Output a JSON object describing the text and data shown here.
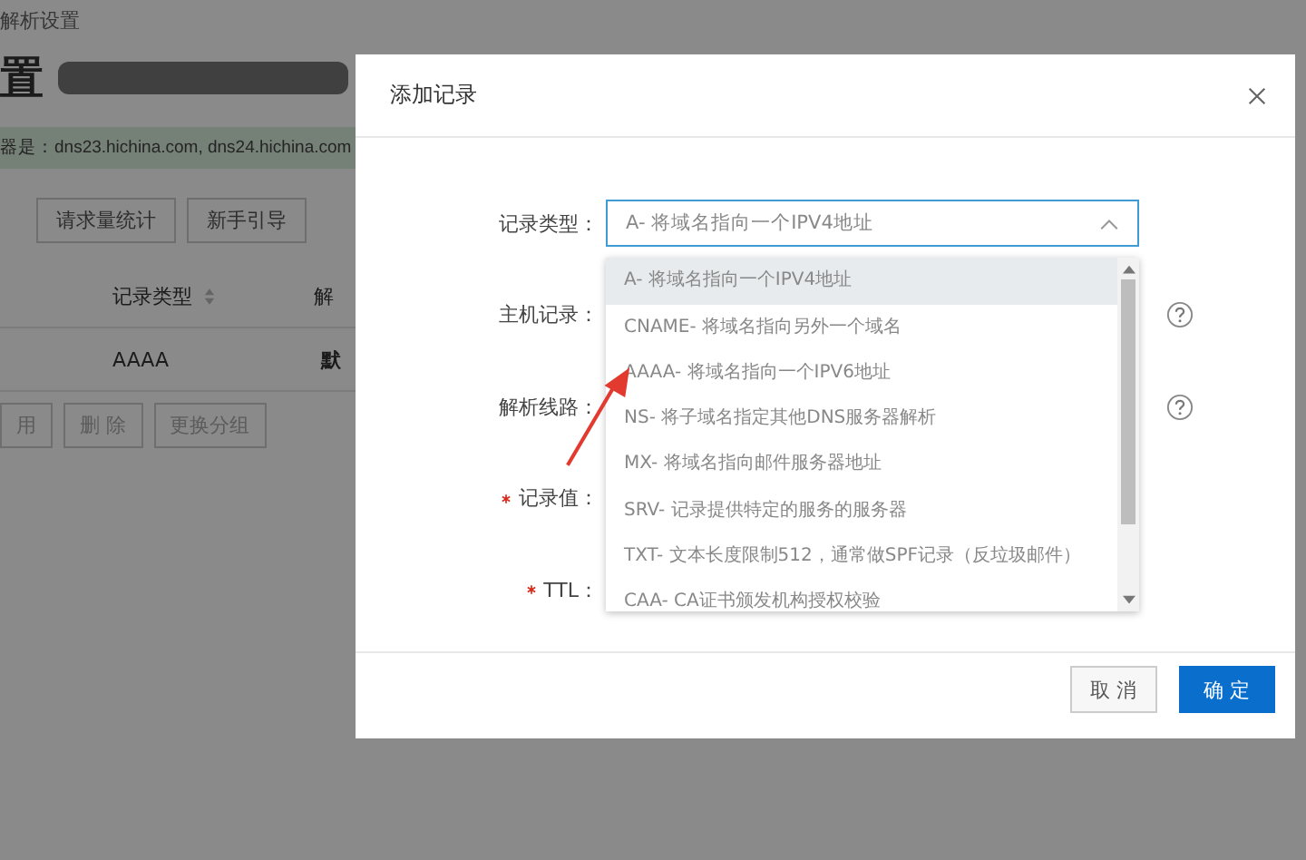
{
  "page": {
    "breadcrumb": "解析设置",
    "heading": "置",
    "dns_notice": "器是：dns23.hichina.com, dns24.hichina.com",
    "toolbar_buttons": [
      "请求量统计",
      "新手引导"
    ],
    "table": {
      "columns": [
        "记录类型",
        "解"
      ],
      "rows": [
        [
          "AAAA",
          "默"
        ]
      ]
    },
    "action_buttons": [
      "用",
      "删 除",
      "更换分组"
    ]
  },
  "dialog": {
    "title": "添加记录",
    "fields": [
      {
        "label": "记录类型：",
        "required": false,
        "help": false
      },
      {
        "label": "主机记录：",
        "required": false,
        "help": true
      },
      {
        "label": "解析线路：",
        "required": false,
        "help": true
      },
      {
        "label": "记录值：",
        "required": true,
        "help": false
      },
      {
        "label": "TTL：",
        "required": true,
        "help": false
      }
    ],
    "select": {
      "value": "A- 将域名指向一个IPV4地址",
      "expanded": true,
      "options": [
        {
          "label": "A- 将域名指向一个IPV4地址",
          "selected": true
        },
        {
          "label": "CNAME- 将域名指向另外一个域名",
          "selected": false
        },
        {
          "label": "AAAA- 将域名指向一个IPV6地址",
          "selected": false
        },
        {
          "label": "NS- 将子域名指定其他DNS服务器解析",
          "selected": false
        },
        {
          "label": "MX- 将域名指向邮件服务器地址",
          "selected": false
        },
        {
          "label": "SRV- 记录提供特定的服务的服务器",
          "selected": false
        },
        {
          "label": "TXT- 文本长度限制512，通常做SPF记录（反垃圾邮件）",
          "selected": false
        },
        {
          "label": "CAA- CA证书颁发机构授权校验",
          "selected": false
        }
      ]
    },
    "buttons": [
      {
        "label": "取 消",
        "kind": "secondary"
      },
      {
        "label": "确 定",
        "kind": "primary"
      }
    ]
  }
}
